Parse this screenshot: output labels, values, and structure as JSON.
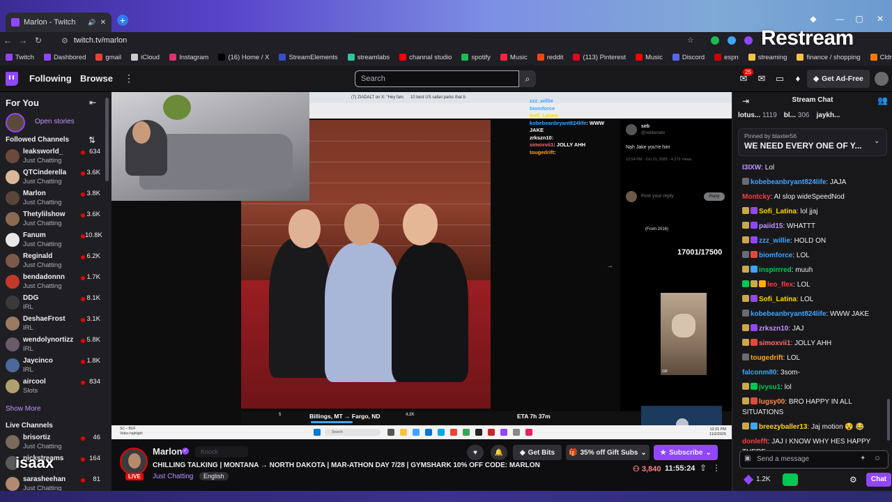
{
  "browser": {
    "tab_title": "Marlon - Twitch",
    "url": "twitch.tv/marlon",
    "overlay_brand": "Restream",
    "bookmarks": [
      {
        "label": "Twitch",
        "color": "#9146ff"
      },
      {
        "label": "Dashbored",
        "color": "#9146ff"
      },
      {
        "label": "gmail",
        "color": "#ea4335"
      },
      {
        "label": "iCloud",
        "color": "#cccccc"
      },
      {
        "label": "Instagram",
        "color": "#e1306c"
      },
      {
        "label": "(16) Home / X",
        "color": "#000000"
      },
      {
        "label": "StreamElements",
        "color": "#3b4cca"
      },
      {
        "label": "streamlabs",
        "color": "#31c3a2"
      },
      {
        "label": "channal studio",
        "color": "#ff0000"
      },
      {
        "label": "spotify",
        "color": "#1db954"
      },
      {
        "label": "Music",
        "color": "#fa243c"
      },
      {
        "label": "reddit",
        "color": "#ff4500"
      },
      {
        "label": "(113) Pinterest",
        "color": "#e60023"
      },
      {
        "label": "Music",
        "color": "#ff0000"
      },
      {
        "label": "Discord",
        "color": "#5865f2"
      },
      {
        "label": "espn",
        "color": "#cc0000"
      },
      {
        "label": "streaming",
        "color": "#f5c542"
      },
      {
        "label": "finance / shopping",
        "color": "#f5c542"
      },
      {
        "label": "Cldropshipping",
        "color": "#ff7a00"
      }
    ]
  },
  "topnav": {
    "following": "Following",
    "browse": "Browse",
    "search_placeholder": "Search",
    "notif_count": "25",
    "get_adfree": "Get Ad-Free"
  },
  "sidebar": {
    "for_you": "For You",
    "open_stories": "Open stories",
    "followed_header": "Followed Channels",
    "followed": [
      {
        "name": "leaksworld_",
        "category": "Just Chatting",
        "viewers": "634",
        "color": "#6a4a3a"
      },
      {
        "name": "QTCinderella",
        "category": "Just Chatting",
        "viewers": "3.6K",
        "color": "#d9b89a"
      },
      {
        "name": "Marlon",
        "category": "Just Chatting",
        "viewers": "3.8K",
        "color": "#5a4638"
      },
      {
        "name": "Thetylilshow",
        "category": "Just Chatting",
        "viewers": "3.6K",
        "color": "#8a6a52"
      },
      {
        "name": "Fanum",
        "category": "Just Chatting",
        "viewers": "10.8K",
        "color": "#e8e8e8"
      },
      {
        "name": "Reginald",
        "category": "Just Chatting",
        "viewers": "6.2K",
        "color": "#7a5a4a"
      },
      {
        "name": "bendadonnn",
        "category": "Just Chatting",
        "viewers": "1.7K",
        "color": "#c0392b"
      },
      {
        "name": "DDG",
        "category": "IRL",
        "viewers": "8.1K",
        "color": "#3a3a3a"
      },
      {
        "name": "DeshaeFrost",
        "category": "IRL",
        "viewers": "3.1K",
        "color": "#9a7a62"
      },
      {
        "name": "wendolynortizz",
        "category": "IRL",
        "viewers": "5.8K",
        "color": "#6a5a6a"
      },
      {
        "name": "Jaycinco",
        "category": "IRL",
        "viewers": "1.8K",
        "color": "#4a6a9a"
      },
      {
        "name": "aircool",
        "category": "Slots",
        "viewers": "834",
        "color": "#b0a070"
      }
    ],
    "show_more": "Show More",
    "live_header": "Live Channels",
    "live": [
      {
        "name": "brisortiz",
        "category": "Just Chatting",
        "viewers": "46",
        "color": "#7a6a5a"
      },
      {
        "name": "nickstreams",
        "category": "",
        "viewers": "164",
        "color": "#5a5a5a"
      },
      {
        "name": "sarasheehan",
        "category": "Just Chatting",
        "viewers": "81",
        "color": "#b08a72"
      }
    ],
    "overlay_text": "isaax"
  },
  "video": {
    "screen_tabs": [
      "(7) ZIADALT on X: \"Hey fam",
      "10 best US safari parks that b"
    ],
    "overlay_chat": [
      {
        "user": "zzz_willie",
        "msg": "",
        "color": "#3ea6ff"
      },
      {
        "user": "biomforce",
        "msg": "",
        "color": "#3ea6ff"
      },
      {
        "user": "Sofi_Latina",
        "msg": "",
        "color": "#ffd700"
      },
      {
        "user": "kobebeanbryant824life",
        "msg": "WWW JAKE",
        "color": "#3ea6ff"
      },
      {
        "user": "zrkszn10",
        "msg": "",
        "color": "#fff"
      },
      {
        "user": "simoxvii1",
        "msg": "JOLLY AHH",
        "color": "#ff6b6b"
      },
      {
        "user": "tougedrift",
        "msg": "",
        "color": "#ffa500"
      }
    ],
    "tweet": {
      "author": "seb",
      "handle": "@sebbenato",
      "text": "Nah Jake you're him",
      "meta": "12:54 PM · Oct 31, 2025 · 4,272 Views",
      "reply_placeholder": "Post your reply",
      "reply_btn": "Reply",
      "reply1_note": "(From 2016)",
      "gif_label": "GIF"
    },
    "counter_overlay": "17001/17500",
    "route_from": "Billings, MT → Fargo, ND",
    "eta": "ETA 7h 37m",
    "route_comments": "5",
    "route_views": "4.2K",
    "taskbar_label": "SC – BUF\nVideo highlight",
    "taskbar_clock": "12:21 PM\n11/2/2025",
    "taskbar_search": "Search"
  },
  "stream": {
    "streamer": "Marlon",
    "knock": "Knock",
    "title": "CHILLING TALKING | MONTANA → NORTH DAKOTA | MAR-ATHON DAY 7/28 | GYMSHARK 10% OFF CODE: MARLON",
    "category": "Just Chatting",
    "language": "English",
    "live": "LIVE",
    "get_bits": "Get Bits",
    "gift_subs": "35% off Gift Subs",
    "subscribe": "Subscribe",
    "viewers": "3,840",
    "uptime": "11:55:24"
  },
  "chat": {
    "title": "Stream Chat",
    "gifters": [
      {
        "name": "lotus...",
        "count": "1119"
      },
      {
        "name": "bl...",
        "count": "306"
      },
      {
        "name": "jaykh...",
        "count": ""
      }
    ],
    "pinned_by": "Pinned by blaxter56",
    "pinned_msg": "WE NEED EVERY ONE OF Y...",
    "messages": [
      {
        "user": "I3IXW",
        "text": "Lol",
        "color": "#bf94ff",
        "badges": []
      },
      {
        "user": "kobebeanbryant824life",
        "text": "JAJA",
        "color": "#3ea6ff",
        "badges": [
          "#6a6a72"
        ]
      },
      {
        "user": "Montcky",
        "text": "AI slop wideSpeedNod",
        "color": "#ff3b3b",
        "badges": []
      },
      {
        "user": "Sofi_Latina",
        "text": "lol jjaj",
        "color": "#ffd700",
        "badges": [
          "#c8a84b",
          "#9146ff"
        ]
      },
      {
        "user": "paiid15",
        "text": "WHATTT",
        "color": "#bf94ff",
        "badges": [
          "#c8a84b",
          "#9146ff"
        ]
      },
      {
        "user": "zzz_willie",
        "text": "HOLD ON",
        "color": "#3ea6ff",
        "badges": [
          "#c8a84b",
          "#9146ff"
        ]
      },
      {
        "user": "biomforce",
        "text": "LOL",
        "color": "#3ea6ff",
        "badges": [
          "#6a6a72",
          "#e04a3a"
        ]
      },
      {
        "user": "inspirrred",
        "text": "muuh",
        "color": "#00c853",
        "badges": [
          "#c8a84b",
          "#3ea6ff"
        ]
      },
      {
        "user": "leo_flex",
        "text": "LOL",
        "color": "#ff3b3b",
        "badges": [
          "#00c853",
          "#c8a84b",
          "#ffb000"
        ]
      },
      {
        "user": "Sofi_Latina",
        "text": "LOL",
        "color": "#ffd700",
        "badges": [
          "#c8a84b",
          "#9146ff"
        ]
      },
      {
        "user": "kobebeanbryant824life",
        "text": "WWW JAKE",
        "color": "#3ea6ff",
        "badges": [
          "#6a6a72"
        ]
      },
      {
        "user": "zrkszn10",
        "text": "JAJ",
        "color": "#bf94ff",
        "badges": [
          "#c8a84b",
          "#9146ff"
        ]
      },
      {
        "user": "simoxvii1",
        "text": "JOLLY AHH",
        "color": "#ff6b6b",
        "badges": [
          "#c8a84b",
          "#e04a3a"
        ]
      },
      {
        "user": "tougedrift",
        "text": "LOL",
        "color": "#ffa500",
        "badges": [
          "#6a6a72"
        ]
      },
      {
        "user": "falconm80",
        "text": "3som-",
        "color": "#3ea6ff",
        "badges": []
      },
      {
        "user": "jvysu1",
        "text": "lol",
        "color": "#00c853",
        "badges": [
          "#c8a84b",
          "#00c853"
        ]
      },
      {
        "user": "lugsy00",
        "text": "BRO HAPPY IN ALL SITUATIONS",
        "color": "#ff8c42",
        "badges": [
          "#c8a84b",
          "#e04a3a"
        ]
      },
      {
        "user": "breezyballer13",
        "text": "Jaj motion 😵 😂",
        "color": "#ffd700",
        "badges": [
          "#c8a84b",
          "#3ea6ff"
        ]
      },
      {
        "user": "donlefft",
        "text": "JAJ I KNOW WHY HES HAPPY THERE",
        "color": "#ff3b3b",
        "badges": []
      }
    ],
    "send_placeholder": "Send a message",
    "bits_count": "1.2K",
    "chat_btn": "Chat"
  },
  "colors": {
    "twitch_purple": "#9146ff",
    "live_red": "#eb0400",
    "link_purple": "#bf94ff"
  }
}
